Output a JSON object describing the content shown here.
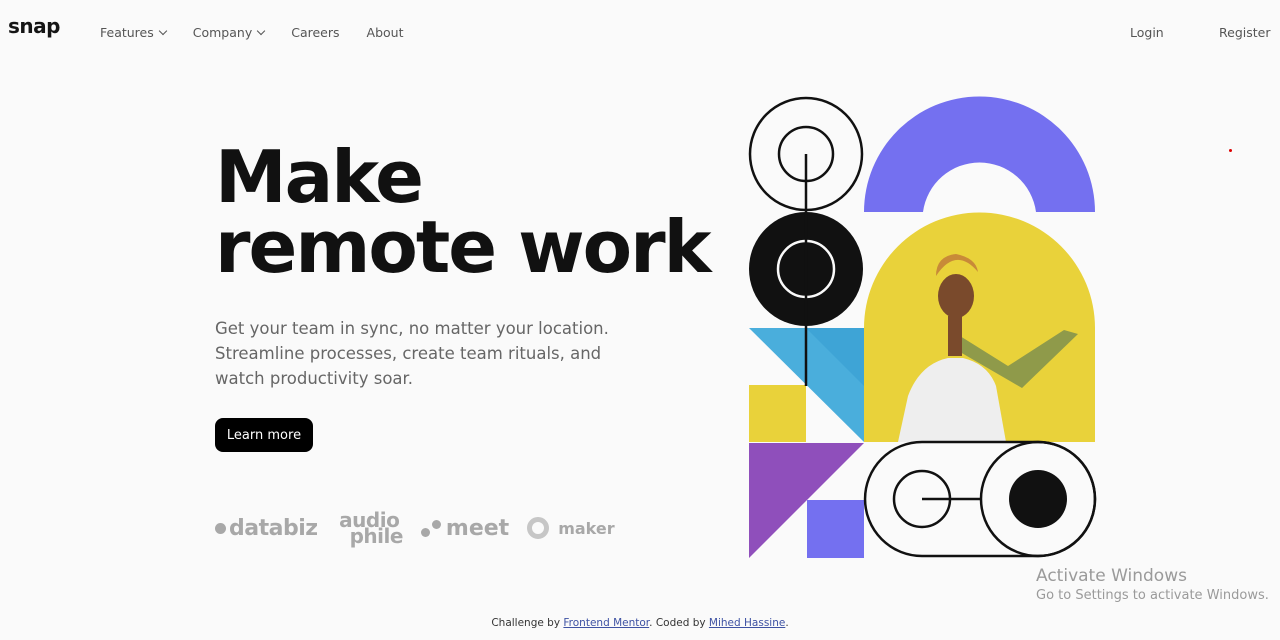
{
  "brand": {
    "logo": "snap"
  },
  "nav": {
    "items": [
      {
        "label": "Features",
        "dropdown": true
      },
      {
        "label": "Company",
        "dropdown": true
      },
      {
        "label": "Careers",
        "dropdown": false
      },
      {
        "label": "About",
        "dropdown": false
      }
    ],
    "login": "Login",
    "register": "Register"
  },
  "hero": {
    "title_line1": "Make",
    "title_line2": "remote work",
    "text": "Get your team in sync, no matter your location. Streamline processes, create team rituals, and watch productivity soar.",
    "button": "Learn more"
  },
  "clients": {
    "databiz": "databiz",
    "audiophile_top": "audio",
    "audiophile_bottom": "phile",
    "meet": "meet",
    "maker": "maker"
  },
  "illustration": {
    "colors": {
      "purple": "#7470f0",
      "yellow": "#e9d23a",
      "blue": "#4aaedc",
      "violet": "#8f4fbb",
      "black": "#111111"
    }
  },
  "watermark": {
    "title": "Activate Windows",
    "subtitle": "Go to Settings to activate Windows."
  },
  "footer": {
    "prefix": "Challenge by ",
    "link1": "Frontend Mentor",
    "middle": ". Coded by ",
    "link2": "Mihed Hassine",
    "suffix": "."
  }
}
